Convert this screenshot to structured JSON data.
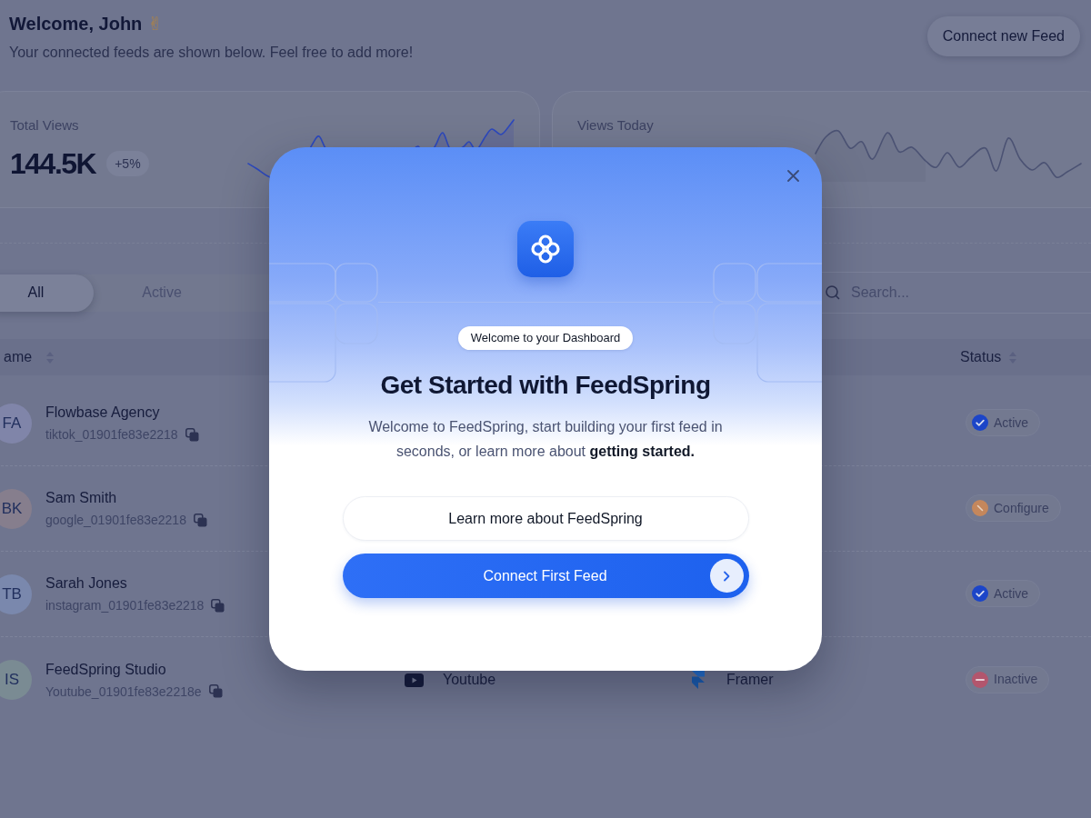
{
  "header": {
    "title": "Welcome, John",
    "emoji": "✌",
    "subtitle": "Your connected feeds are shown below. Feel free to add more!",
    "button": "Connect new Feed"
  },
  "stats": [
    {
      "label": "Total Views",
      "value": "144.5K",
      "change": "+5%"
    },
    {
      "label": "Views Today"
    }
  ],
  "tabs": [
    {
      "label": "All",
      "selected": true
    },
    {
      "label": "Active",
      "selected": false
    }
  ],
  "search": {
    "placeholder": "Search..."
  },
  "table": {
    "columns": [
      {
        "label": "ame",
        "sortable": true
      },
      {
        "label": "Status",
        "sortable": true
      }
    ],
    "rows": [
      {
        "avatar": {
          "initials": "FA",
          "color": "#8085a9"
        },
        "name": "Flowbase Agency",
        "id": "tiktok_01901fe83e2218",
        "status": {
          "kind": "active",
          "label": "Active",
          "color": "#1c45c8"
        }
      },
      {
        "avatar": {
          "initials": "BK",
          "color": "#867e8d"
        },
        "name": "Sam Smith",
        "id": "google_01901fe83e2218",
        "status": {
          "kind": "configure",
          "label": "Configure",
          "color": "#c4875c"
        }
      },
      {
        "avatar": {
          "initials": "TB",
          "color": "#7a88ad"
        },
        "name": "Sarah Jones",
        "id": "instagram_01901fe83e2218",
        "status": {
          "kind": "active",
          "label": "Active",
          "color": "#1c45c8"
        }
      },
      {
        "avatar": {
          "initials": "IS",
          "color": "#7a8b93"
        },
        "name": "FeedSpring Studio",
        "id": "Youtube_01901fe83e2218e",
        "column_2": {
          "kind": "youtube",
          "text": "Youtube"
        },
        "column_3": {
          "kind": "framer",
          "text": "Framer"
        },
        "status": {
          "kind": "inactive",
          "label": "Inactive",
          "color": "#b2566d"
        }
      }
    ]
  },
  "modal": {
    "badge": "Welcome to your Dashboard",
    "title": "Get Started with FeedSpring",
    "text": "Welcome to FeedSpring, start building your first feed in seconds, or learn more about **getting started.**",
    "secondary_button": "Learn more about FeedSpring",
    "primary_button": "Connect First Feed"
  }
}
